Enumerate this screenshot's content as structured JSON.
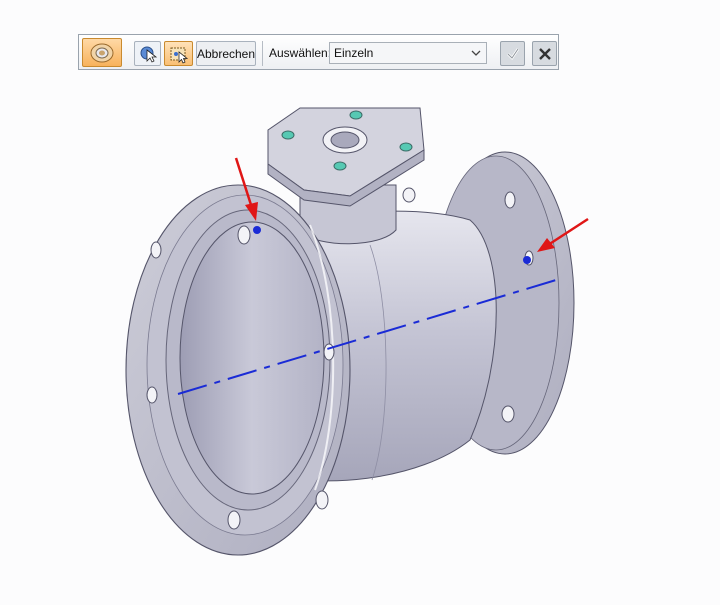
{
  "toolbar": {
    "command_icon": "ball-valve-feature-icon",
    "select_mode_icons": [
      "cursor-select-icon",
      "face-select-icon"
    ],
    "cancel_label": "Abbrechen",
    "select_label": "Auswählen:",
    "select_value": "Einzeln",
    "accept_icon": "checkmark-icon",
    "close_icon": "close-icon"
  },
  "viewport": {
    "model": "ball-valve-body",
    "axis_color": "#1a2bd6",
    "selection_point_color": "#1a2bd6",
    "arrow_color": "#e01616"
  }
}
